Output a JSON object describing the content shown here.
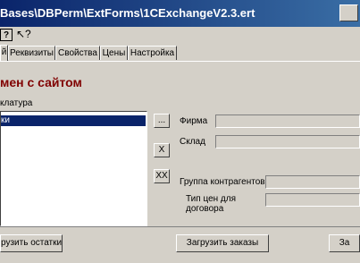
{
  "window": {
    "title": "Bases\\DBPerm\\ExtForms\\1CExchangeV2.3.ert"
  },
  "toolbar": {
    "help_icon": "help-icon",
    "context_help_icon": "context-help-icon"
  },
  "tabs": [
    {
      "label": "й",
      "active": true
    },
    {
      "label": "Реквизиты"
    },
    {
      "label": "Свойства"
    },
    {
      "label": "Цены"
    },
    {
      "label": "Настройка"
    }
  ],
  "main": {
    "heading": "мен с сайтом",
    "list_label": "клатура",
    "list_items": [
      "ки"
    ],
    "browse_label": "...",
    "clear_label": "X",
    "clear_all_label": "XX",
    "firm_label": "Фирма",
    "warehouse_label": "Склад",
    "contractor_group_label": "Группа контрагентов",
    "price_type_label_1": "Тип цен для",
    "price_type_label_2": "договора"
  },
  "footer": {
    "upload_stock_label": "рузить остатки",
    "load_orders_label": "Загрузить заказы",
    "third_label": "За"
  }
}
